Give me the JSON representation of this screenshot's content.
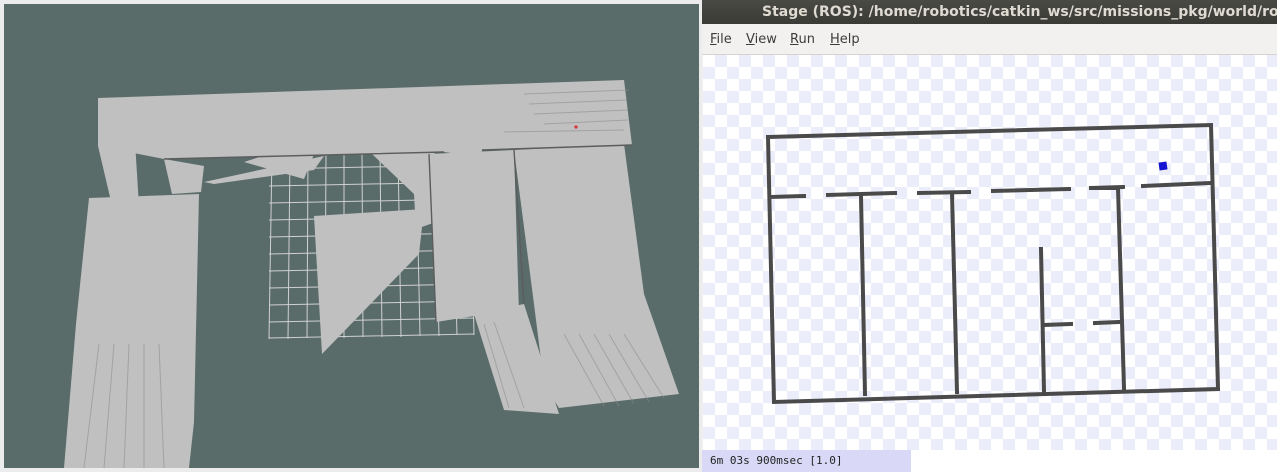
{
  "rviz": {
    "background_color": "#5a6c6a",
    "map_free_color": "#c0c0c0",
    "grid_color": "#d0d0d0"
  },
  "stage": {
    "title": "Stage (ROS): /home/robotics/catkin_ws/src/missions_pkg/world/robotics",
    "menu": [
      {
        "id": "file",
        "mnemonic": "F",
        "rest": "ile"
      },
      {
        "id": "view",
        "mnemonic": "V",
        "rest": "iew"
      },
      {
        "id": "run",
        "mnemonic": "R",
        "rest": "un"
      },
      {
        "id": "help",
        "mnemonic": "H",
        "rest": "elp"
      }
    ],
    "sim_time": "6m 03s 900msec [1.0]",
    "wall_color": "#4a4a4a",
    "robot_color": "#1414d2"
  }
}
